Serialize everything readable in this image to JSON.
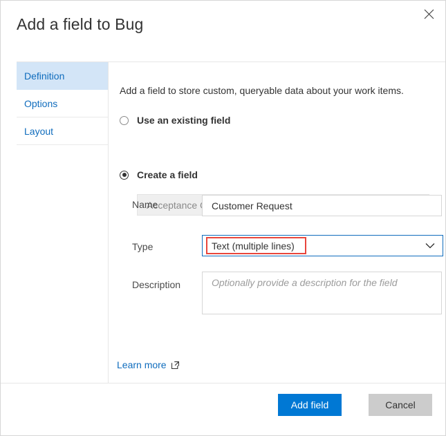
{
  "dialog": {
    "title": "Add a field to Bug",
    "close_icon": "close-icon"
  },
  "sidebar": {
    "items": [
      {
        "label": "Definition",
        "selected": true
      },
      {
        "label": "Options",
        "selected": false
      },
      {
        "label": "Layout",
        "selected": false
      }
    ]
  },
  "main": {
    "intro": "Add a field to store custom, queryable data about your work items.",
    "existing_field": {
      "radio_label": "Use an existing field",
      "selected": false,
      "select_value": "Acceptance Criteria",
      "disabled": true
    },
    "create_field": {
      "radio_label": "Create a field",
      "selected": true,
      "name": {
        "label": "Name",
        "value": "Customer Request"
      },
      "type": {
        "label": "Type",
        "value": "Text (multiple lines)",
        "chevron_icon": "chevron-down-icon",
        "focused": true,
        "annotated": true
      },
      "description": {
        "label": "Description",
        "placeholder": "Optionally provide a description for the field",
        "value": ""
      }
    },
    "learn_more": {
      "label": "Learn more",
      "icon": "external-link-icon"
    }
  },
  "footer": {
    "primary_label": "Add field",
    "secondary_label": "Cancel"
  },
  "colors": {
    "accent_blue": "#0078d4",
    "link_blue": "#0f6cbd",
    "selected_tab_bg": "#d3e5f7",
    "annotation_red": "#e8453c",
    "disabled_bg": "#efefef",
    "secondary_button_bg": "#cccccc",
    "border_gray": "#d6d6d6"
  }
}
